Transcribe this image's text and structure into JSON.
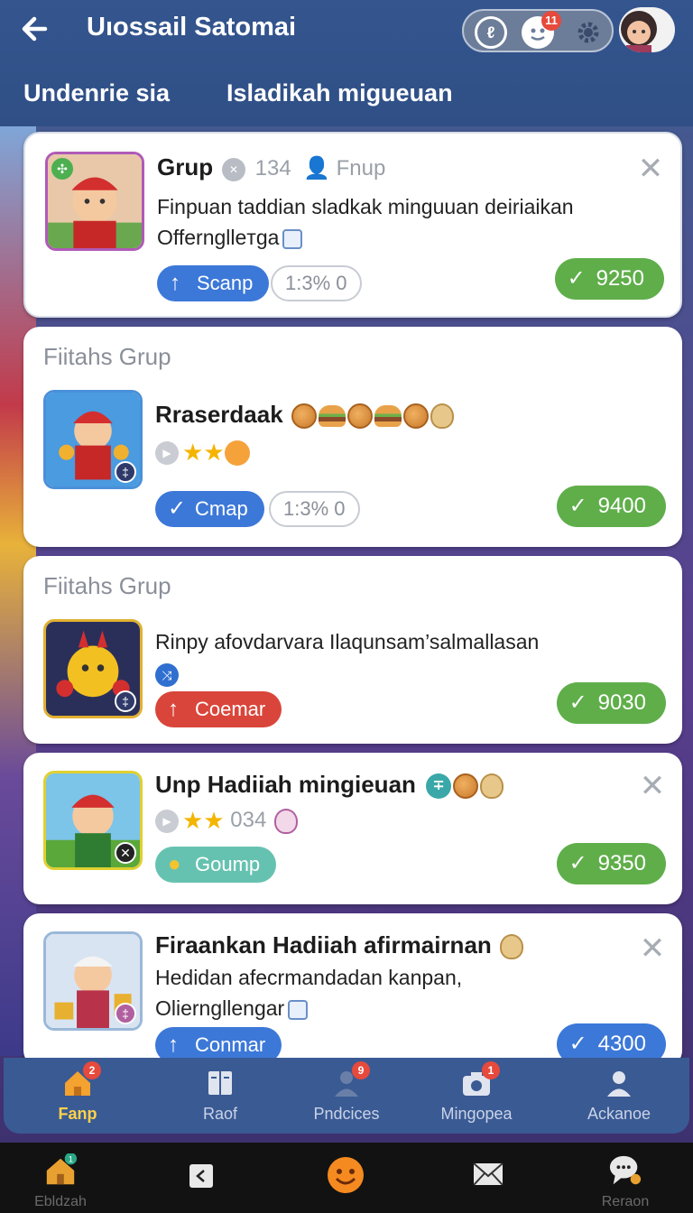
{
  "header": {
    "title": "Uıossail Satomai",
    "pill_badge_count": "11",
    "tabs": [
      {
        "label": "Undenrie sia"
      },
      {
        "label": "Isladikah  migueuan"
      }
    ]
  },
  "cards": [
    {
      "title": "Grup",
      "meta_count": "134",
      "meta_user": "Fnup",
      "desc_line1": "Finpuan taddian sladkak minguuan deiriaikan",
      "desc_line2": "Offernglleтga",
      "button_label": "Scanp",
      "pill_label": "1:3% 0",
      "reward": "9250"
    },
    {
      "section": "Fiitahs Grup",
      "title": "Rraserdaak",
      "button_label": "Cmap",
      "pill_label": "1:3% 0",
      "reward": "9400"
    },
    {
      "section": "Fiitahs Grup",
      "title": "Rinpy afovdarvara Ilaqunsam’salmallasan",
      "button_label": "Coemar",
      "reward": "9030"
    },
    {
      "title": "Unp Hadiiah mingieuan",
      "meta_count": "034",
      "button_label": "Goump",
      "reward": "9350"
    },
    {
      "title": "Firaankan Hadiiah afirmairnan",
      "desc_line1": "Hedidan afecrmandadan kanpan,",
      "desc_line2": "Olierngllengar",
      "button_label": "Conmar",
      "reward": "4300"
    }
  ],
  "app_nav": [
    {
      "label": "Fanp",
      "badge": "2",
      "icon": "home-icon"
    },
    {
      "label": "Raof",
      "icon": "book-icon"
    },
    {
      "label": "Pndcices",
      "badge": "9",
      "icon": "person-icon"
    },
    {
      "label": "Mingopea",
      "badge": "1",
      "icon": "camera-icon"
    },
    {
      "label": "Ackanoe",
      "icon": "person-icon"
    }
  ],
  "system_bar": [
    {
      "label": "Ebldzah",
      "badge": "1",
      "icon": "home-icon"
    },
    {
      "label": "",
      "icon": "back-icon"
    },
    {
      "label": "",
      "icon": "smile-icon"
    },
    {
      "label": "",
      "icon": "mail-icon"
    },
    {
      "label": "Reraon",
      "icon": "chat-icon"
    }
  ],
  "colors": {
    "header_bg": "#34558e",
    "reward_green": "#5fae4a",
    "button_blue": "#3c78d8",
    "button_red": "#d9453a",
    "button_teal": "#66c2b0",
    "nav_active": "#ffd24a"
  }
}
